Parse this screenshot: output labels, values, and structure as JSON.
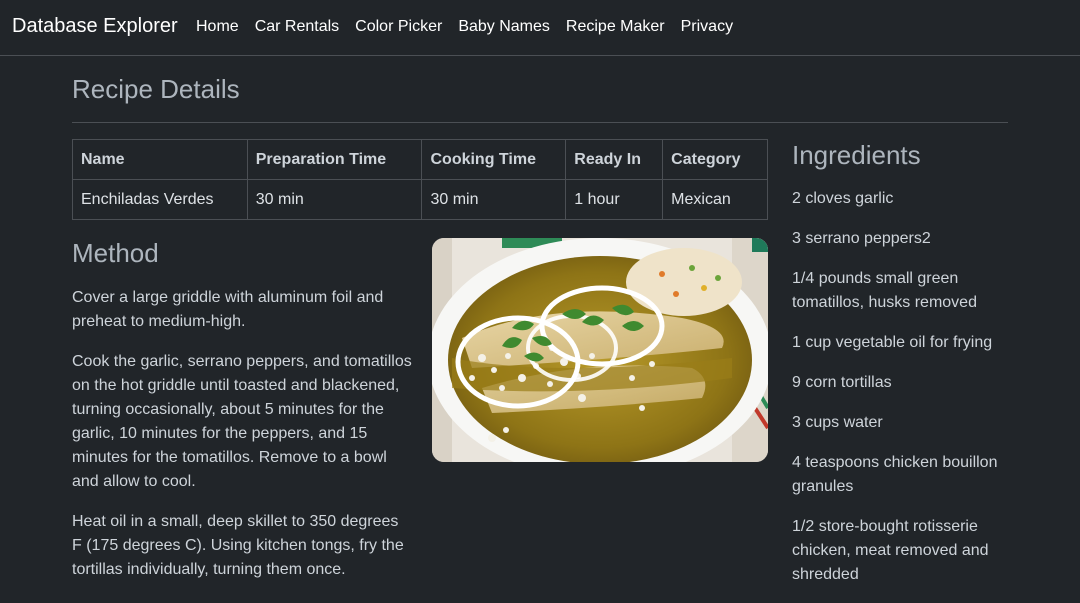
{
  "nav": {
    "brand": "Database Explorer",
    "links": [
      "Home",
      "Car Rentals",
      "Color Picker",
      "Baby Names",
      "Recipe Maker",
      "Privacy"
    ]
  },
  "page": {
    "title": "Recipe Details"
  },
  "details_table": {
    "headers": [
      "Name",
      "Preparation Time",
      "Cooking Time",
      "Ready In",
      "Category"
    ],
    "row": [
      "Enchiladas Verdes",
      "30 min",
      "30 min",
      "1 hour",
      "Mexican"
    ]
  },
  "method": {
    "heading": "Method",
    "steps": [
      "Cover a large griddle with aluminum foil and preheat to medium-high.",
      "Cook the garlic, serrano peppers, and tomatillos on the hot griddle until toasted and blackened, turning occasionally, about 5 minutes for the garlic, 10 minutes for the peppers, and 15 minutes for the tomatillos. Remove to a bowl and allow to cool.",
      "Heat oil in a small, deep skillet to 350 degrees F (175 degrees C). Using kitchen tongs, fry the tortillas individually, turning them once."
    ]
  },
  "ingredients": {
    "heading": "Ingredients",
    "items": [
      "2 cloves garlic",
      "3 serrano peppers2",
      "1/4 pounds small green tomatillos, husks removed",
      "1 cup vegetable oil for frying",
      "9 corn tortillas",
      "3 cups water",
      "4 teaspoons chicken bouillon granules",
      "1/2 store-bought rotisserie chicken, meat removed and shredded"
    ]
  }
}
